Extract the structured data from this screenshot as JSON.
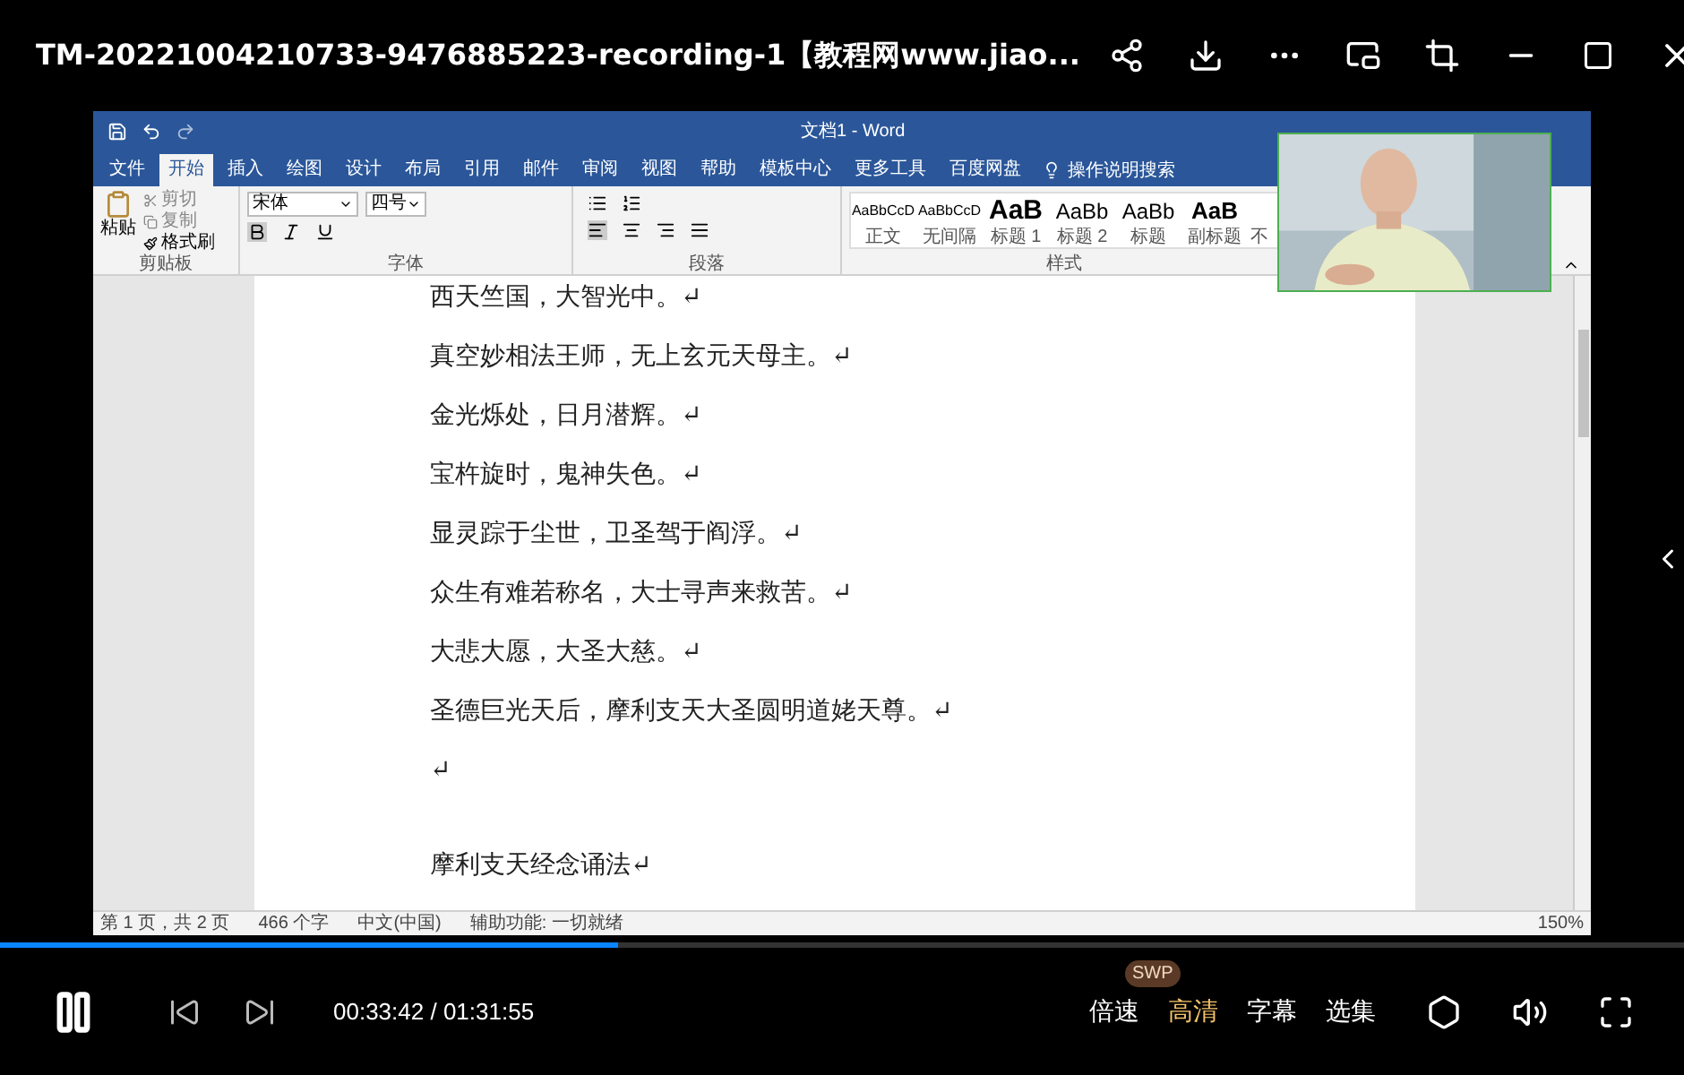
{
  "player": {
    "title": "TM-20221004210733-9476885223-recording-1【教程网www.jiao...",
    "playing": true,
    "progress": {
      "level": 0.367
    },
    "time": "00:33:42 / 01:31:55",
    "badge": "SWP",
    "options": [
      {
        "label": "倍速",
        "selected": false
      },
      {
        "label": "高清",
        "selected": true
      },
      {
        "label": "字幕",
        "selected": false
      },
      {
        "label": "选集",
        "selected": false
      }
    ]
  },
  "word": {
    "title": "文档1 - Word",
    "tabs": [
      {
        "label": "文件",
        "selected": false
      },
      {
        "label": "开始",
        "selected": true
      },
      {
        "label": "插入",
        "selected": false
      },
      {
        "label": "绘图",
        "selected": false
      },
      {
        "label": "设计",
        "selected": false
      },
      {
        "label": "布局",
        "selected": false
      },
      {
        "label": "引用",
        "selected": false
      },
      {
        "label": "邮件",
        "selected": false
      },
      {
        "label": "审阅",
        "selected": false
      },
      {
        "label": "视图",
        "selected": false
      },
      {
        "label": "帮助",
        "selected": false
      },
      {
        "label": "模板中心",
        "selected": false
      },
      {
        "label": "更多工具",
        "selected": false
      },
      {
        "label": "百度网盘",
        "selected": false
      }
    ],
    "search": "操作说明搜索",
    "clipboard": {
      "paste": "粘贴",
      "cut": "剪切",
      "copy": "复制",
      "format_painter": "格式刷",
      "label": "剪贴板"
    },
    "font": {
      "name": "宋体",
      "size": "四号",
      "label": "字体"
    },
    "paragraph": {
      "label": "段落"
    },
    "styles": {
      "label": "样式",
      "items": [
        {
          "preview": "AaBbCcD",
          "name": "正文",
          "kind": "body"
        },
        {
          "preview": "AaBbCcD",
          "name": "无间隔",
          "kind": "body"
        },
        {
          "preview": "AaB",
          "name": "标题 1",
          "kind": "heading"
        },
        {
          "preview": "AaBb",
          "name": "标题 2",
          "kind": "subheading"
        },
        {
          "preview": "AaBb",
          "name": "标题",
          "kind": "subheading"
        },
        {
          "preview": "AaB",
          "name": "副标题",
          "kind": "title"
        },
        {
          "name": "不"
        }
      ]
    },
    "paragraphs": [
      "西天竺国，大智光中。↵",
      "真空妙相法王师，无上玄元天母主。↵",
      "金光烁处，日月潜辉。↵",
      "宝杵旋时，鬼神失色。↵",
      "显灵踪于尘世，卫圣驾于阎浮。↵",
      "众生有难若称名，大士寻声来救苦。↵",
      "大悲大愿，大圣大慈。↵",
      "圣德巨光天后，摩利支天大圣圆明道姥天尊。↵",
      "↵",
      "摩利支天经念诵法↵"
    ],
    "status": [
      "第 1 页，共 2 页",
      "466 个字",
      "中文(中国)",
      "辅助功能: 一切就绪"
    ],
    "zoom": "150%"
  }
}
